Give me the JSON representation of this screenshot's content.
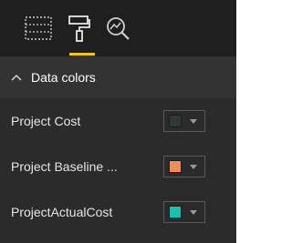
{
  "toolbar": {
    "icons": [
      "fields-icon",
      "format-paint-roller-icon",
      "analytics-magnifier-icon"
    ],
    "active_underline_color": "#f2c811"
  },
  "section": {
    "title": "Data colors",
    "expanded": true
  },
  "rows": [
    {
      "label": "Project Cost",
      "color": "#2f3b3b"
    },
    {
      "label": "Project Baseline ...",
      "color": "#f28c5a"
    },
    {
      "label": "ProjectActualCost",
      "color": "#18c2b3"
    }
  ]
}
